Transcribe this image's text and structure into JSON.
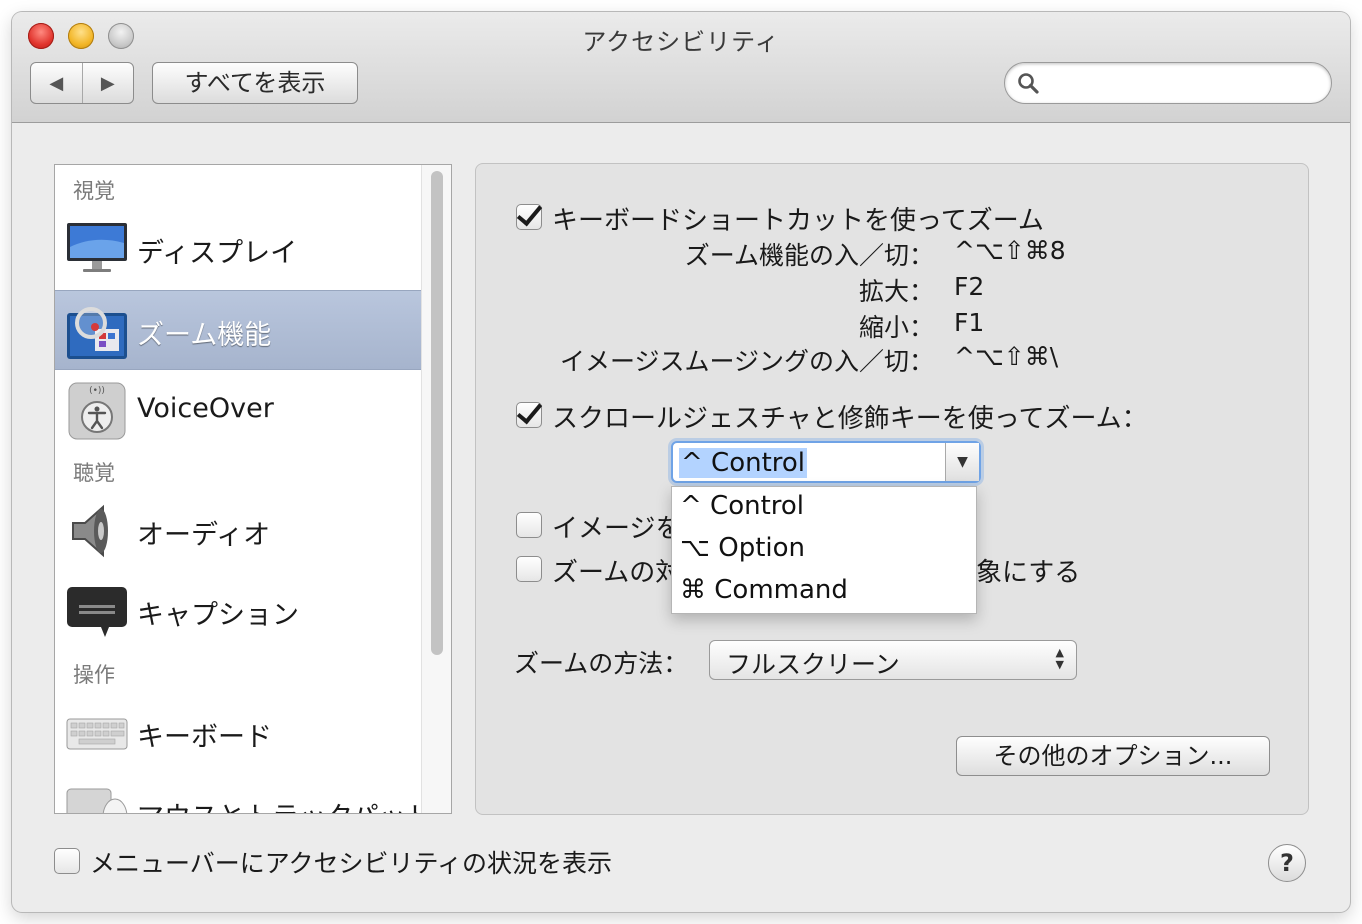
{
  "window": {
    "title": "アクセシビリティ"
  },
  "toolbar": {
    "back_icon": "◀",
    "forward_icon": "▶",
    "show_all_label": "すべてを表示",
    "search_placeholder": "",
    "search_value": ""
  },
  "sidebar": {
    "sections": {
      "vision": "視覚",
      "hearing": "聴覚",
      "interaction": "操作"
    },
    "items": [
      {
        "label": "ディスプレイ",
        "icon": "display-icon",
        "selected": false
      },
      {
        "label": "ズーム機能",
        "icon": "zoom-icon",
        "selected": true
      },
      {
        "label": "VoiceOver",
        "icon": "voiceover-icon",
        "selected": false
      },
      {
        "label": "オーディオ",
        "icon": "speaker-icon",
        "selected": false
      },
      {
        "label": "キャプション",
        "icon": "caption-icon",
        "selected": false
      },
      {
        "label": "キーボード",
        "icon": "keyboard-icon",
        "selected": false
      },
      {
        "label": "マウスとトラックパッド",
        "icon": "mouse-icon",
        "selected": false
      }
    ]
  },
  "zoom": {
    "keyboard_shortcut": {
      "checked": true,
      "label": "キーボードショートカットを使ってズーム"
    },
    "shortcuts": [
      {
        "name": "ズーム機能の入／切：",
        "keys": "^⌥⇧⌘8"
      },
      {
        "name": "拡大：",
        "keys": "F2"
      },
      {
        "name": "縮小：",
        "keys": "F1"
      },
      {
        "name": "イメージスムージングの入／切：",
        "keys": "^⌥⇧⌘\\"
      }
    ],
    "scroll_gesture": {
      "checked": true,
      "label": "スクロールジェスチャと修飾キーを使ってズーム："
    },
    "modifier": {
      "selected": "^ Control",
      "options": [
        "^ Control",
        "⌥ Option",
        "⌘ Command"
      ]
    },
    "image_smoothing": {
      "checked": false,
      "label_visible": "イメージを"
    },
    "follow_focus": {
      "checked": false,
      "label_left": "ズームの対",
      "label_right": "象にする"
    },
    "style": {
      "label": "ズームの方法：",
      "value": "フルスクリーン"
    },
    "more_options_label": "その他のオプション..."
  },
  "footer": {
    "menubar_status": {
      "checked": false,
      "label": "メニューバーにアクセシビリティの状況を表示"
    },
    "help_label": "?"
  }
}
